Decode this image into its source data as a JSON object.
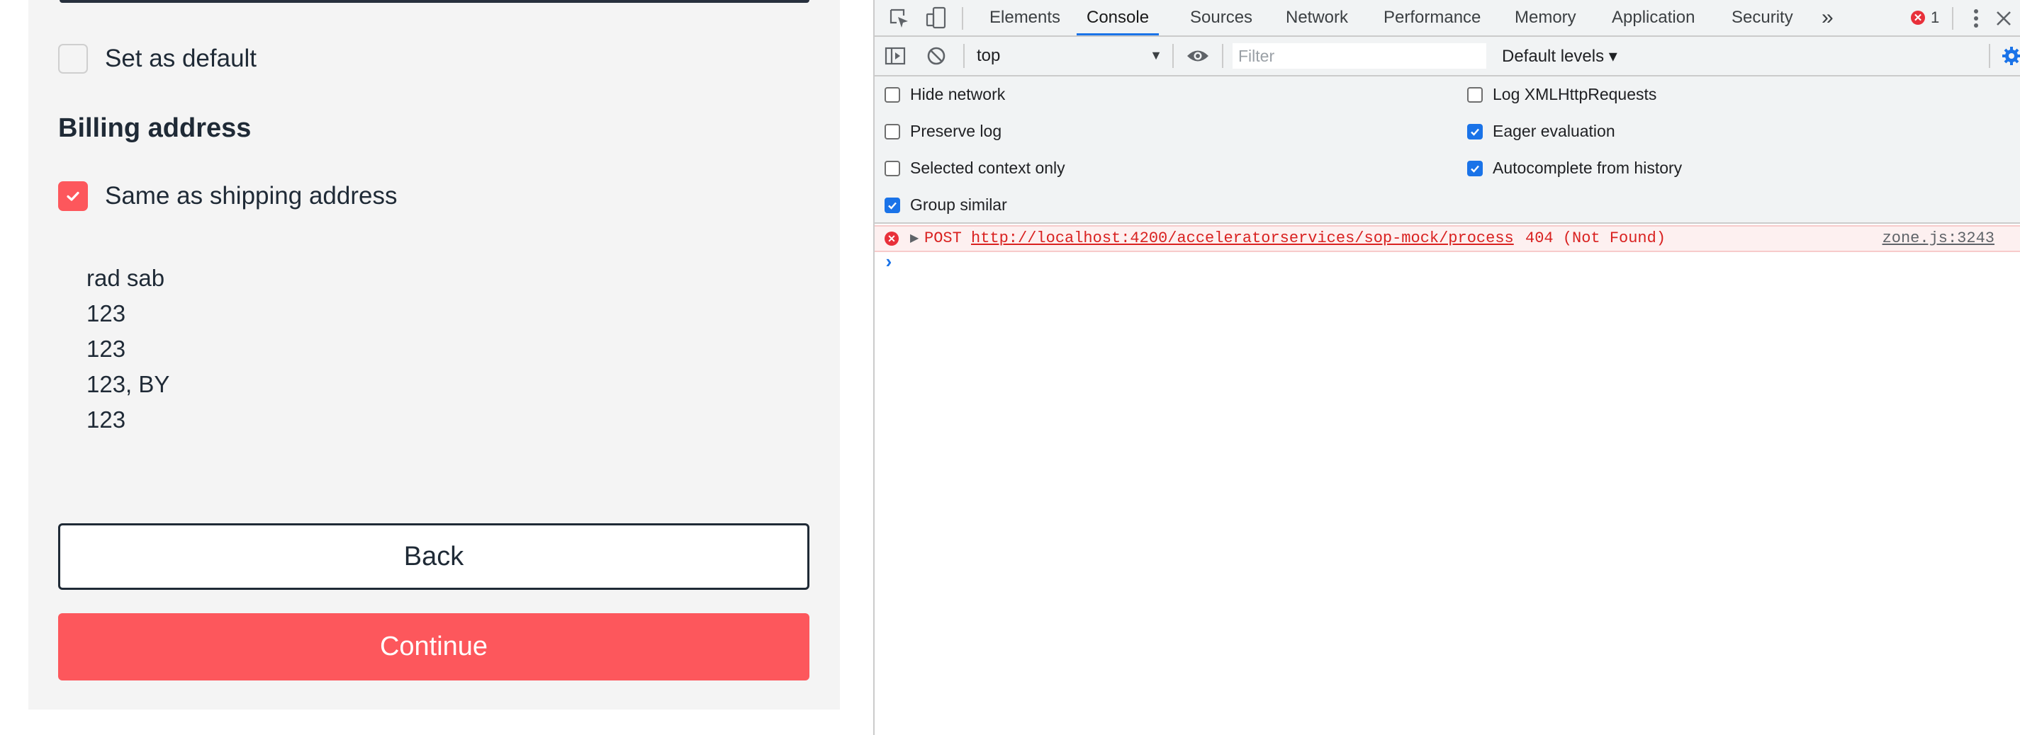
{
  "checkout": {
    "set_default_label": "Set as default",
    "billing_title": "Billing address",
    "same_as_shipping_label": "Same as shipping address",
    "address_lines": [
      "rad sab",
      "123",
      "123",
      "123, BY",
      "123"
    ],
    "back_label": "Back",
    "continue_label": "Continue",
    "accent_color": "#fd575c"
  },
  "devtools": {
    "tabs": [
      "Elements",
      "Console",
      "Sources",
      "Network",
      "Performance",
      "Memory",
      "Application",
      "Security"
    ],
    "active_tab": "Console",
    "more_tabs": "»",
    "error_count": "1",
    "context": "top",
    "filter_placeholder": "Filter",
    "levels_label": "Default levels ▾",
    "settings": {
      "hide_network": "Hide network",
      "preserve_log": "Preserve log",
      "selected_context_only": "Selected context only",
      "group_similar": "Group similar",
      "log_xhr": "Log XMLHttpRequests",
      "eager_evaluation": "Eager evaluation",
      "autocomplete": "Autocomplete from history"
    },
    "settings_checked": {
      "hide_network": false,
      "preserve_log": false,
      "selected_context_only": false,
      "group_similar": true,
      "log_xhr": false,
      "eager_evaluation": true,
      "autocomplete": true
    },
    "error": {
      "method": "POST",
      "url": "http://localhost:4200/acceleratorservices/sop-mock/process",
      "status": "404 (Not Found)",
      "source": "zone.js:3243"
    },
    "prompt": "›"
  }
}
